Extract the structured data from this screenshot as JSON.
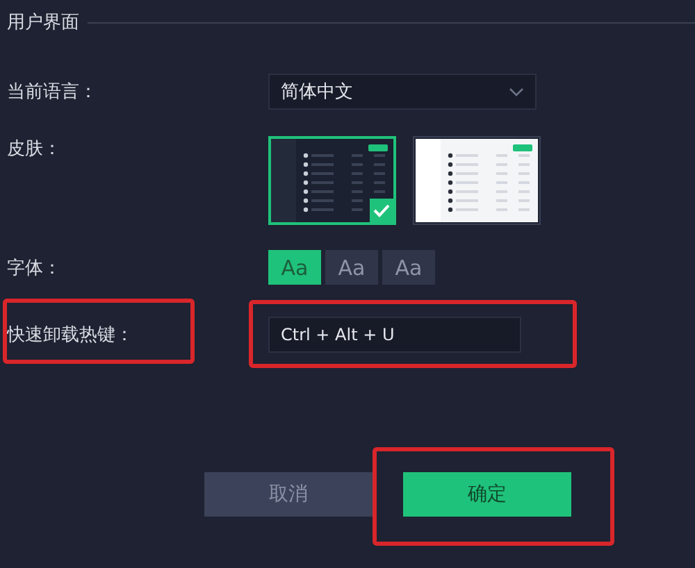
{
  "section": {
    "title": "用户界面"
  },
  "language": {
    "label": "当前语言：",
    "value": "简体中文"
  },
  "skin": {
    "label": "皮肤：",
    "options": [
      {
        "kind": "dark",
        "selected": true
      },
      {
        "kind": "light",
        "selected": false
      }
    ]
  },
  "font": {
    "label": "字体：",
    "options": [
      {
        "label": "Aa",
        "selected": true
      },
      {
        "label": "Aa",
        "selected": false
      },
      {
        "label": "Aa",
        "selected": false
      }
    ]
  },
  "hotkey": {
    "label": "快速卸载热键：",
    "value": "Ctrl + Alt + U",
    "highlighted": true
  },
  "buttons": [
    {
      "label": "取消",
      "kind": "cancel",
      "highlighted": false
    },
    {
      "label": "确定",
      "kind": "confirm",
      "highlighted": true
    }
  ]
}
